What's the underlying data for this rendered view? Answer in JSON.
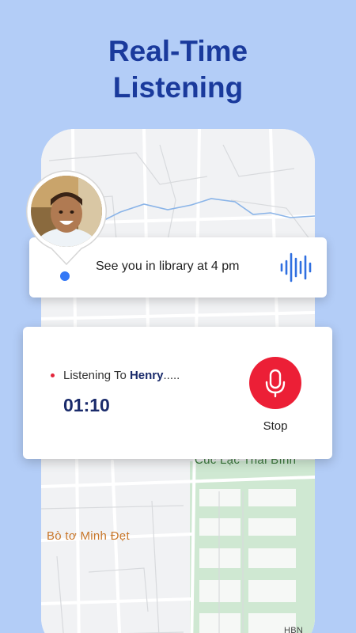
{
  "headline": {
    "line1": "Real-Time",
    "line2": "Listening"
  },
  "map": {
    "label_park": "Cúc Lạc Thái Bình",
    "label_place": "Bò tơ Minh Đẹt",
    "label_corner": "HBN"
  },
  "message": {
    "text": "See you in library at 4 pm"
  },
  "listening": {
    "prefix": "Listening To ",
    "name": "Henry",
    "suffix": ".....",
    "timer": "01:10",
    "stop_label": "Stop"
  },
  "colors": {
    "background": "#b3cdf7",
    "headline": "#1a3a9c",
    "stop_button": "#ec1f36",
    "accent_blue": "#3478f6",
    "name_text": "#1a2b6b"
  }
}
